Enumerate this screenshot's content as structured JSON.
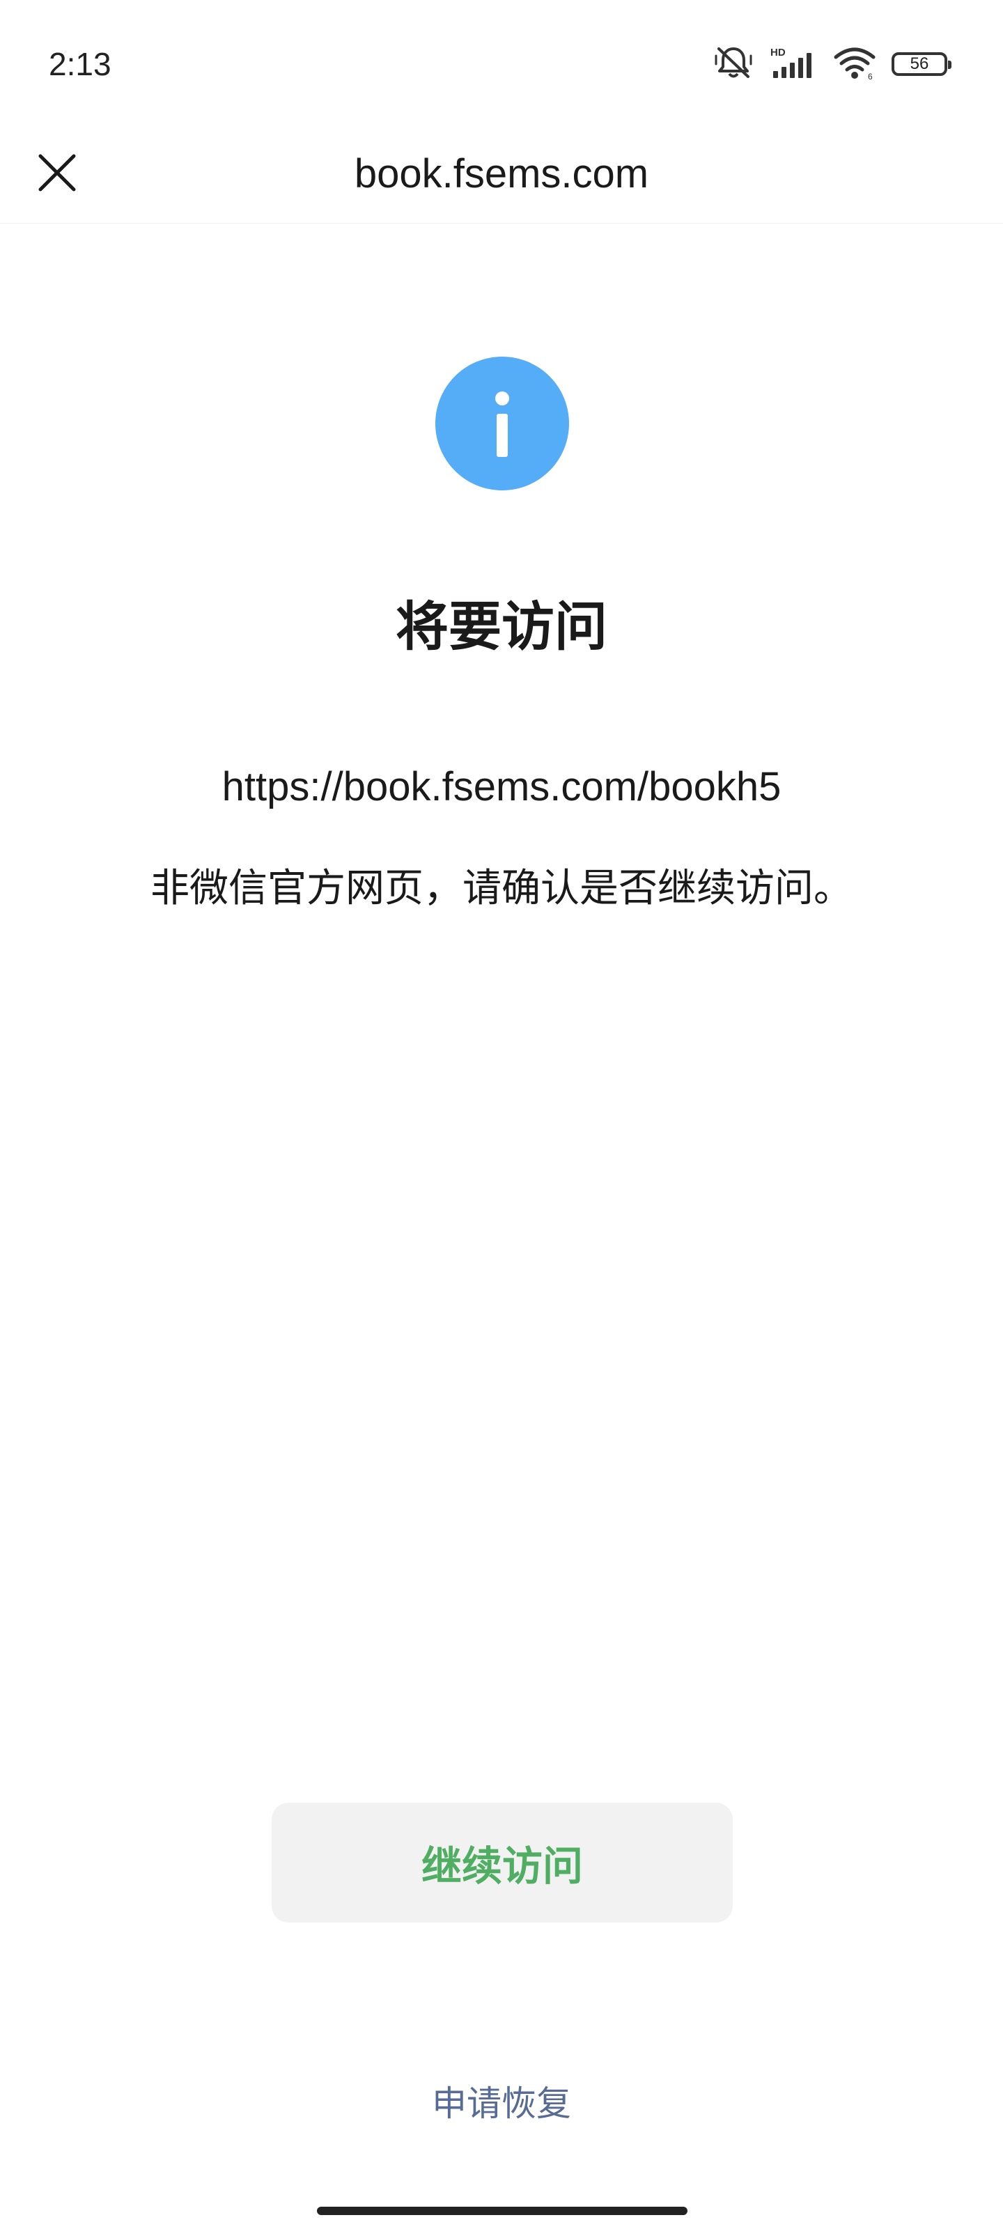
{
  "status_bar": {
    "time": "2:13",
    "battery_level": "56",
    "icons": [
      "bell-muted-icon",
      "hd-signal-icon",
      "wifi-icon",
      "battery-icon"
    ]
  },
  "nav": {
    "title": "book.fsems.com",
    "close_icon": "close-icon"
  },
  "content": {
    "icon": "info-icon",
    "icon_color": "#55acf7",
    "title": "将要访问",
    "url": "https://book.fsems.com/bookh5",
    "warning": "非微信官方网页，请确认是否继续访问。"
  },
  "actions": {
    "continue_label": "继续访问",
    "continue_color": "#4fae61",
    "appeal_label": "申请恢复",
    "appeal_color": "#576b95"
  }
}
